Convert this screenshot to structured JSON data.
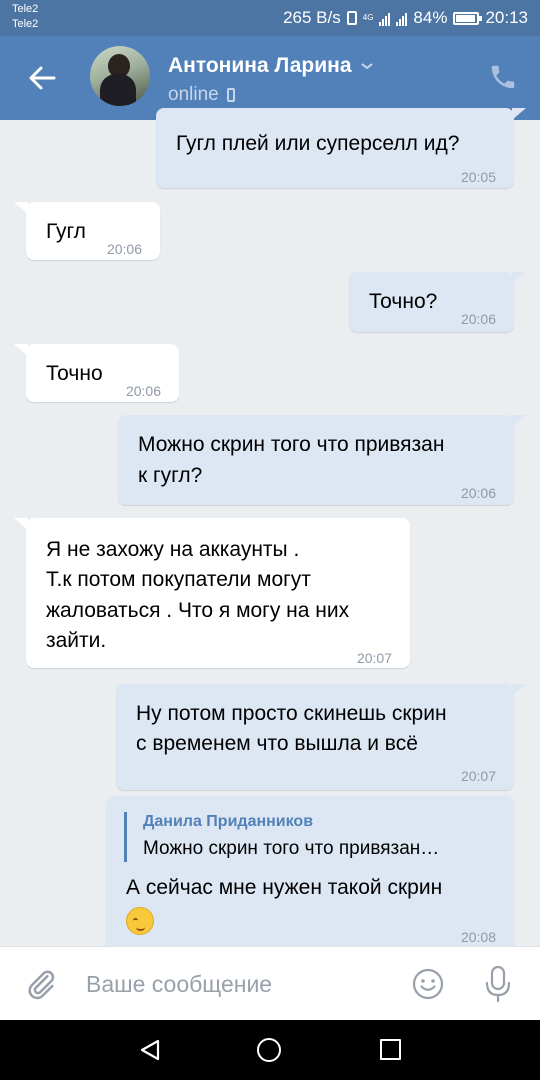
{
  "status_bar": {
    "carrier_1": "Tele2",
    "carrier_2": "Tele2",
    "speed": "265 B/s",
    "network": "4G",
    "battery": "84%",
    "battery_level": 0.84,
    "time": "20:13"
  },
  "header": {
    "contact_name": "Антонина Ларина",
    "status": "online"
  },
  "messages": [
    {
      "direction": "out",
      "text": "Гугл плей или суперселл ид?",
      "time": "20:05"
    },
    {
      "direction": "in",
      "text": "Гугл",
      "time": "20:06"
    },
    {
      "direction": "out",
      "text": "Точно?",
      "time": "20:06"
    },
    {
      "direction": "in",
      "text": "Точно",
      "time": "20:06"
    },
    {
      "direction": "out",
      "lines": [
        "Можно скрин того что привязан",
        "к гугл?"
      ],
      "time": "20:06"
    },
    {
      "direction": "in",
      "lines": [
        "Я не захожу на аккаунты .",
        "Т.к потом покупатели могут",
        "жаловаться . Что я могу на них",
        "зайти."
      ],
      "time": "20:07"
    },
    {
      "direction": "out",
      "lines": [
        "Ну потом просто скинешь скрин",
        "с временем что вышла и всё"
      ],
      "time": "20:07"
    },
    {
      "direction": "out",
      "reply": {
        "author": "Данила Приданников",
        "text": "Можно скрин того что привязан…"
      },
      "text": "А сейчас мне нужен такой скрин",
      "emoji": "relieved-face",
      "time": "20:08"
    }
  ],
  "composer": {
    "placeholder": "Ваше сообщение"
  },
  "colors": {
    "header": "#5181b8",
    "status_bar": "#4d75a3",
    "background": "#ebeef1",
    "outgoing_bubble": "#dde7f3",
    "incoming_bubble": "#ffffff",
    "timestamp": "#909aa5"
  },
  "icons": [
    "back-arrow-icon",
    "dropdown-chevron-icon",
    "mobile-phone-icon",
    "call-icon",
    "attach-paperclip-icon",
    "emoji-smile-icon",
    "microphone-icon",
    "nav-back-icon",
    "nav-home-icon",
    "nav-recent-icon"
  ]
}
